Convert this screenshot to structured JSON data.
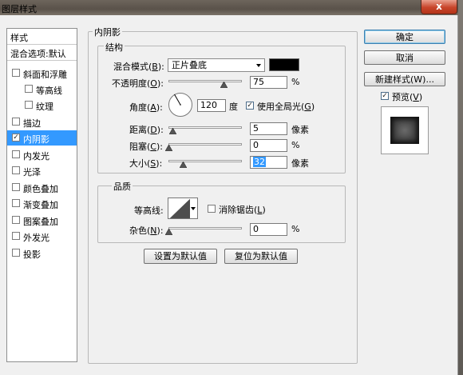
{
  "window": {
    "title": "图层样式",
    "close_label": "x"
  },
  "sidebar": {
    "header": "样式",
    "blend_options": "混合选项:默认",
    "items": [
      {
        "label": "斜面和浮雕",
        "checked": false
      },
      {
        "label": "等高线",
        "checked": false
      },
      {
        "label": "纹理",
        "checked": false
      },
      {
        "label": "描边",
        "checked": false
      },
      {
        "label": "内阴影",
        "checked": true
      },
      {
        "label": "内发光",
        "checked": false
      },
      {
        "label": "光泽",
        "checked": false
      },
      {
        "label": "颜色叠加",
        "checked": false
      },
      {
        "label": "渐变叠加",
        "checked": false
      },
      {
        "label": "图案叠加",
        "checked": false
      },
      {
        "label": "外发光",
        "checked": false
      },
      {
        "label": "投影",
        "checked": false
      }
    ],
    "check_mark": "✓"
  },
  "inner_shadow": {
    "section_title": "内阴影",
    "structure": {
      "title": "结构",
      "blend_mode_label": "混合模式",
      "blend_mode_key": "B",
      "blend_mode_value": "正片叠底",
      "blend_color": "#000000",
      "opacity_label": "不透明度",
      "opacity_key": "O",
      "opacity_value": "75",
      "opacity_unit": "%",
      "opacity_fraction": 0.75,
      "angle_label": "角度",
      "angle_key": "A",
      "angle_value": "120",
      "angle_unit": "度",
      "global_light_label": "使用全局光",
      "global_light_key": "G",
      "global_light_checked": true,
      "distance_label": "距离",
      "distance_key": "D",
      "distance_value": "5",
      "distance_unit": "像素",
      "choke_label": "阻塞",
      "choke_key": "C",
      "choke_value": "0",
      "choke_unit": "%",
      "size_label": "大小",
      "size_key": "S",
      "size_value": "32",
      "size_unit": "像素"
    },
    "quality": {
      "title": "品质",
      "contour_label": "等高线",
      "anti_alias_label": "消除锯齿",
      "anti_alias_key": "L",
      "anti_alias_checked": false,
      "noise_label": "杂色",
      "noise_key": "N",
      "noise_value": "0",
      "noise_unit": "%"
    },
    "set_default_label": "设置为默认值",
    "reset_default_label": "复位为默认值"
  },
  "actions": {
    "ok_label": "确定",
    "cancel_label": "取消",
    "new_style_label": "新建样式(W)...",
    "preview_label": "预览",
    "preview_key": "V",
    "preview_checked": true
  },
  "colors": {
    "selection": "#3399ff",
    "close_button": "#c8442a"
  }
}
